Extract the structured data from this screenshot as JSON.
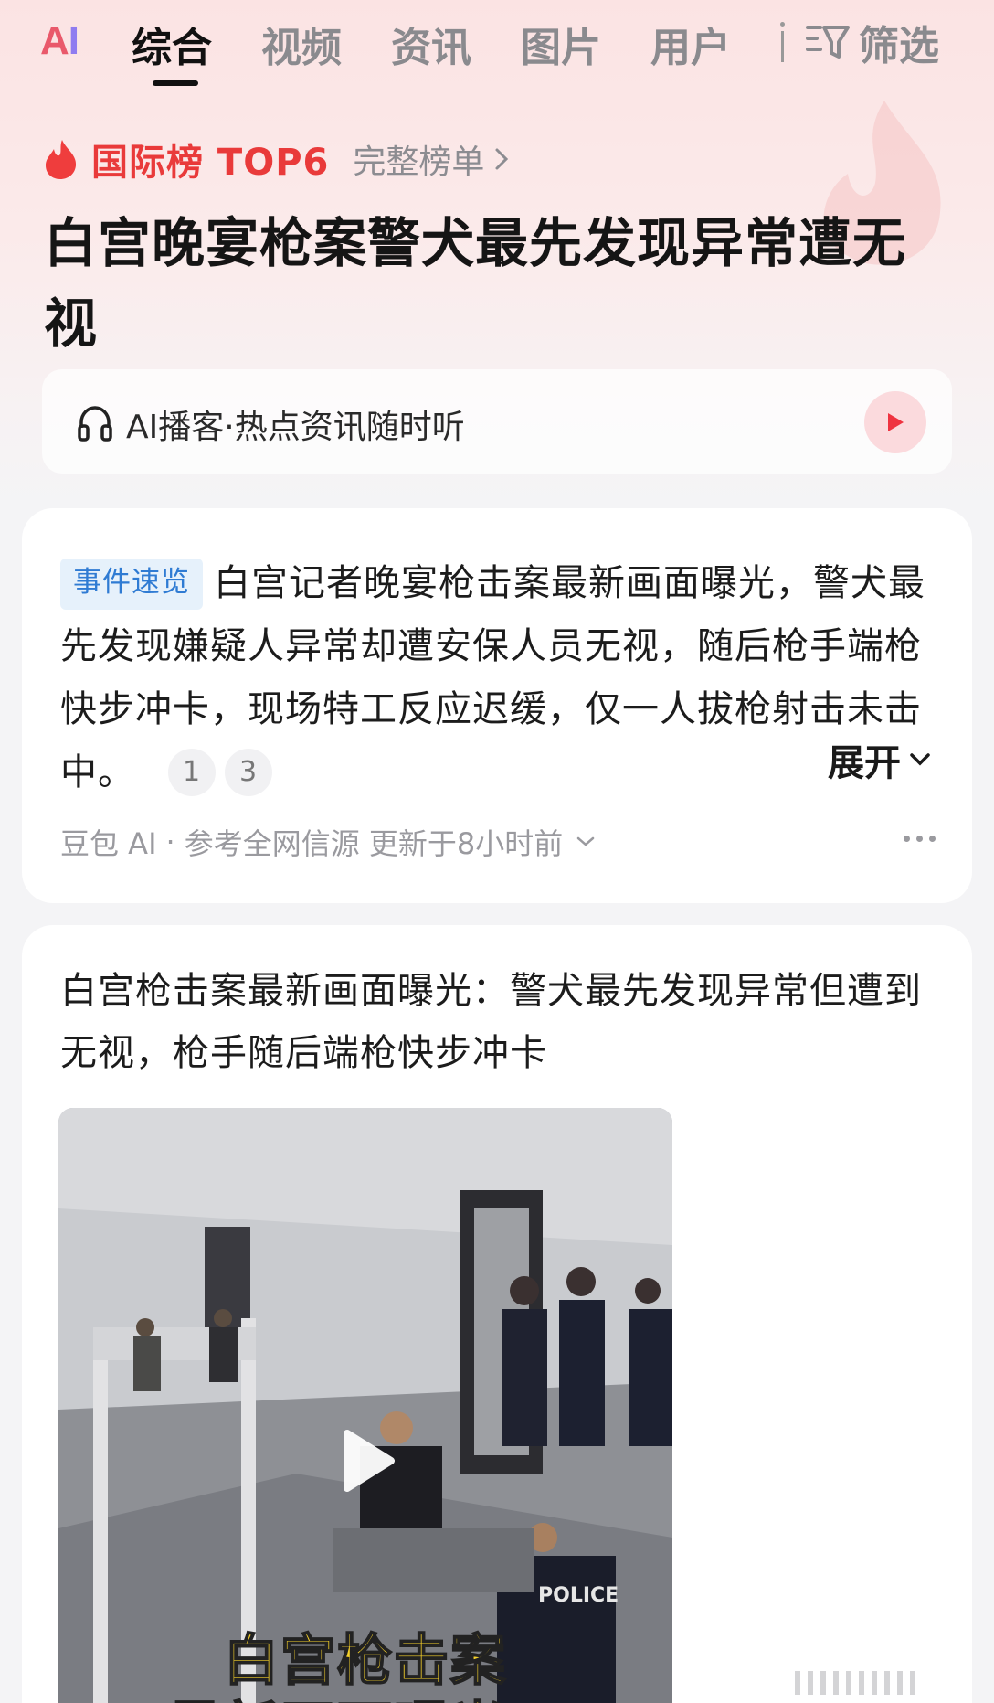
{
  "tabbar": {
    "logo_a": "A",
    "logo_i": "I",
    "tabs": [
      {
        "label": "综合",
        "active": true
      },
      {
        "label": "视频",
        "active": false
      },
      {
        "label": "资讯",
        "active": false
      },
      {
        "label": "图片",
        "active": false
      },
      {
        "label": "用户",
        "active": false
      }
    ],
    "filter_label": "筛选"
  },
  "ranking": {
    "title": "国际榜 TOP6",
    "full_list_link": "完整榜单"
  },
  "headline": "白宫晚宴枪案警犬最先发现异常遭无视",
  "podcast": {
    "label": "AI播客·热点资讯随时听"
  },
  "summary_card": {
    "badge": "事件速览",
    "text": "白宫记者晚宴枪击案最新画面曝光，警犬最先发现嫌疑人异常却遭安保人员无视，随后枪手端枪快步冲卡，现场特工反应迟缓，仅一人拔枪射击未击中。",
    "refs": [
      "1",
      "3"
    ],
    "expand_label": "展开",
    "source": "豆包 AI",
    "dot": "·",
    "source_note": "参考全网信源 更新于8小时前"
  },
  "article_card": {
    "title": "白宫枪击案最新画面曝光：警犬最先发现异常但遭到无视，枪手随后端枪快步冲卡",
    "video_caption_line1": "白宫枪击案",
    "video_caption_line2": "最新画面曝光：",
    "video_badge_text": "POLICE"
  },
  "colors": {
    "accent_red": "#e93a3a",
    "badge_blue": "#2f7bd3",
    "caption_yellow": "#f6d12a"
  }
}
